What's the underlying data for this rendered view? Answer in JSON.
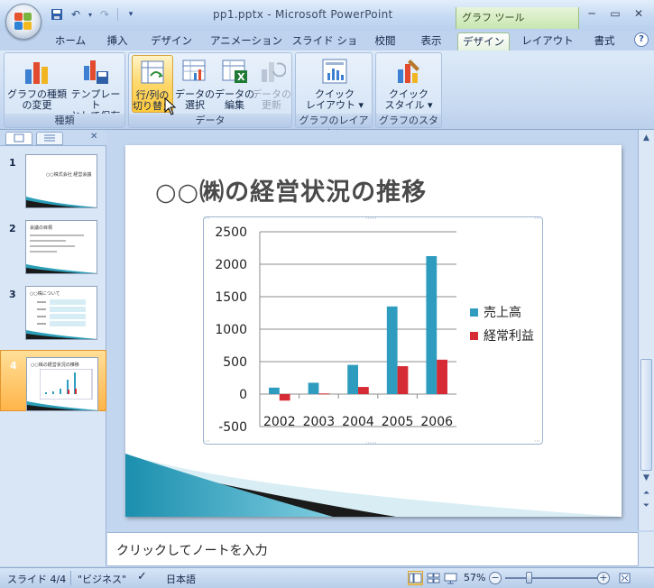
{
  "window": {
    "title": "pp1.pptx - Microsoft PowerPoint",
    "context_tools": "グラフ ツール"
  },
  "tabs": [
    {
      "label": "ホーム"
    },
    {
      "label": "挿入"
    },
    {
      "label": "デザイン"
    },
    {
      "label": "アニメーション"
    },
    {
      "label": "スライド ショー"
    },
    {
      "label": "校閲"
    },
    {
      "label": "表示"
    },
    {
      "label": "デザイン",
      "active": true
    },
    {
      "label": "レイアウト"
    },
    {
      "label": "書式"
    }
  ],
  "ribbon": {
    "groups": [
      {
        "label": "種類",
        "buttons": [
          {
            "line1": "グラフの種類",
            "line2": "の変更",
            "icon": "change-chart-type-icon"
          },
          {
            "line1": "テンプレート",
            "line2": "として保存",
            "icon": "save-template-icon"
          }
        ]
      },
      {
        "label": "データ",
        "buttons": [
          {
            "line1": "行/列の",
            "line2": "切り替え",
            "icon": "switch-row-column-icon",
            "hover": true
          },
          {
            "line1": "データの",
            "line2": "選択",
            "icon": "select-data-icon"
          },
          {
            "line1": "データの",
            "line2": "編集",
            "icon": "edit-data-icon"
          },
          {
            "line1": "データの",
            "line2": "更新",
            "icon": "refresh-data-icon",
            "disabled": true
          }
        ]
      },
      {
        "label": "グラフのレイアウト",
        "buttons": [
          {
            "line1": "クイック",
            "line2": "レイアウト ▾",
            "icon": "quick-layout-icon"
          }
        ]
      },
      {
        "label": "グラフのスタイル",
        "buttons": [
          {
            "line1": "クイック",
            "line2": "スタイル ▾",
            "icon": "quick-style-icon"
          }
        ]
      }
    ]
  },
  "slides_pane": {
    "thumbnails": [
      {
        "number": "1",
        "title": "○○株式会社 経営会議"
      },
      {
        "number": "2",
        "title": "会議の目標"
      },
      {
        "number": "3",
        "title": "○○株について"
      },
      {
        "number": "4",
        "title": "○○株の経営状況の推移",
        "selected": true
      }
    ]
  },
  "slide": {
    "title": "○○㈱の経営状況の推移"
  },
  "chart_data": {
    "type": "bar",
    "categories": [
      "2002",
      "2003",
      "2004",
      "2005",
      "2006"
    ],
    "series": [
      {
        "name": "売上高",
        "color": "#2e9cbf",
        "values": [
          100,
          175,
          450,
          1350,
          2125
        ]
      },
      {
        "name": "経常利益",
        "color": "#d62a35",
        "values": [
          -100,
          10,
          110,
          430,
          530
        ]
      }
    ],
    "ylim": [
      -500,
      2500
    ],
    "yticks": [
      "2500",
      "2000",
      "1500",
      "1000",
      "500",
      "0",
      "-500"
    ],
    "grid": true,
    "legend_position": "right"
  },
  "notes": {
    "placeholder": "クリックしてノートを入力"
  },
  "statusbar": {
    "slide_info": "スライド 4/4",
    "theme": "\"ビジネス\"",
    "language": "日本語",
    "zoom": "57%"
  }
}
